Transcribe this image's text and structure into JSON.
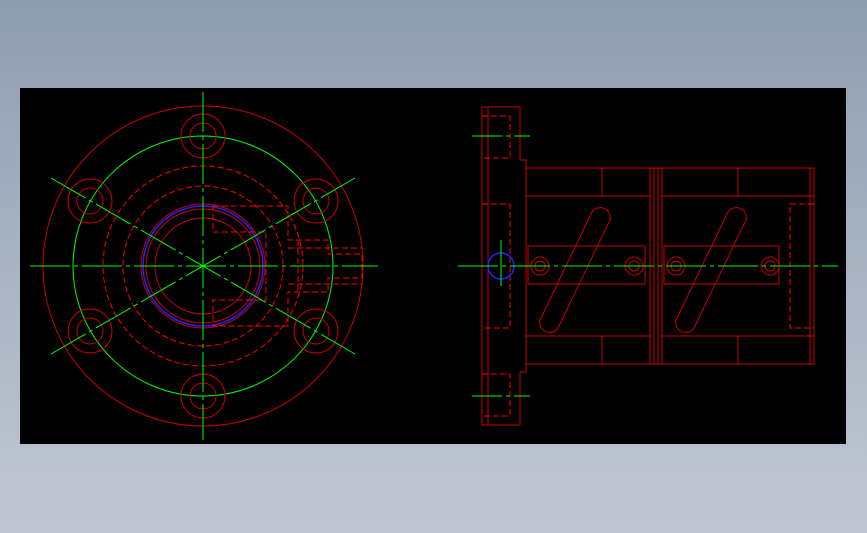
{
  "drawing": {
    "background": "#000000",
    "page_background_top": "#8e9cb0",
    "page_background_bottom": "#c1c6d2",
    "colors": {
      "outline": "#ff0000",
      "hidden_line": "#ff0000",
      "centerline": "#00ff00",
      "highlight_circle": "#0000ff"
    },
    "views": [
      {
        "name": "front-view",
        "description_visible": false
      },
      {
        "name": "side-view",
        "description_visible": false
      }
    ]
  }
}
